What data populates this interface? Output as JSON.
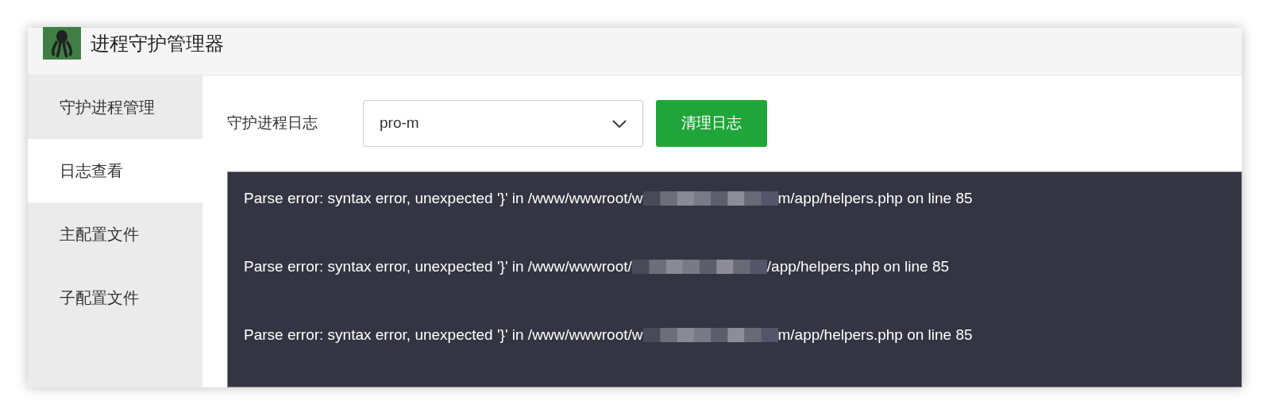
{
  "window": {
    "title": "进程守护管理器"
  },
  "sidebar": {
    "items": [
      {
        "label": "守护进程管理",
        "selected": false
      },
      {
        "label": "日志查看",
        "selected": true
      },
      {
        "label": "主配置文件",
        "selected": false
      },
      {
        "label": "子配置文件",
        "selected": false
      }
    ]
  },
  "toolbar": {
    "label": "守护进程日志",
    "select": {
      "value": "pro-m"
    },
    "button": "清理日志"
  },
  "log": {
    "lines": [
      {
        "before": "Parse error: syntax error, unexpected '}' in /www/wwwroot/w",
        "after": "m/app/helpers.php on line 85"
      },
      {
        "before": "Parse error: syntax error, unexpected '}' in /www/wwwroot/",
        "after": "/app/helpers.php on line 85"
      },
      {
        "before": "Parse error: syntax error, unexpected '}' in /www/wwwroot/w",
        "after": "m/app/helpers.php on line 85"
      }
    ]
  }
}
